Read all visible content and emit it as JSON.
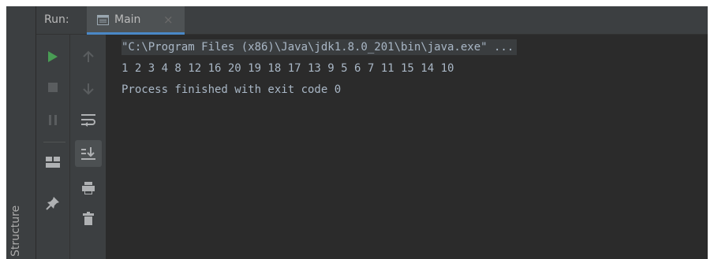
{
  "side_panel": {
    "structure_label": "Structure"
  },
  "run_panel": {
    "run_label": "Run:",
    "tab": {
      "label": "Main",
      "close_glyph": "×"
    }
  },
  "toolbar": {
    "icons": [
      "run-icon",
      "stop-icon",
      "pause-icon",
      "layout-icon",
      "pin-icon",
      "up-arrow-icon",
      "down-arrow-icon",
      "soft-wrap-icon",
      "scroll-to-end-icon",
      "print-icon",
      "trash-icon"
    ]
  },
  "console": {
    "command": "\"C:\\Program Files (x86)\\Java\\jdk1.8.0_201\\bin\\java.exe\" ...",
    "output": "1 2 3 4 8 12 16 20 19 18 17 13 9 5 6 7 11 15 14 10",
    "exit_message": "Process finished with exit code 0"
  },
  "colors": {
    "run_green": "#499c54",
    "text": "#a9b7c6",
    "tab_underline": "#4a88c7",
    "background": "#2b2b2b",
    "panel": "#3c3f41"
  }
}
